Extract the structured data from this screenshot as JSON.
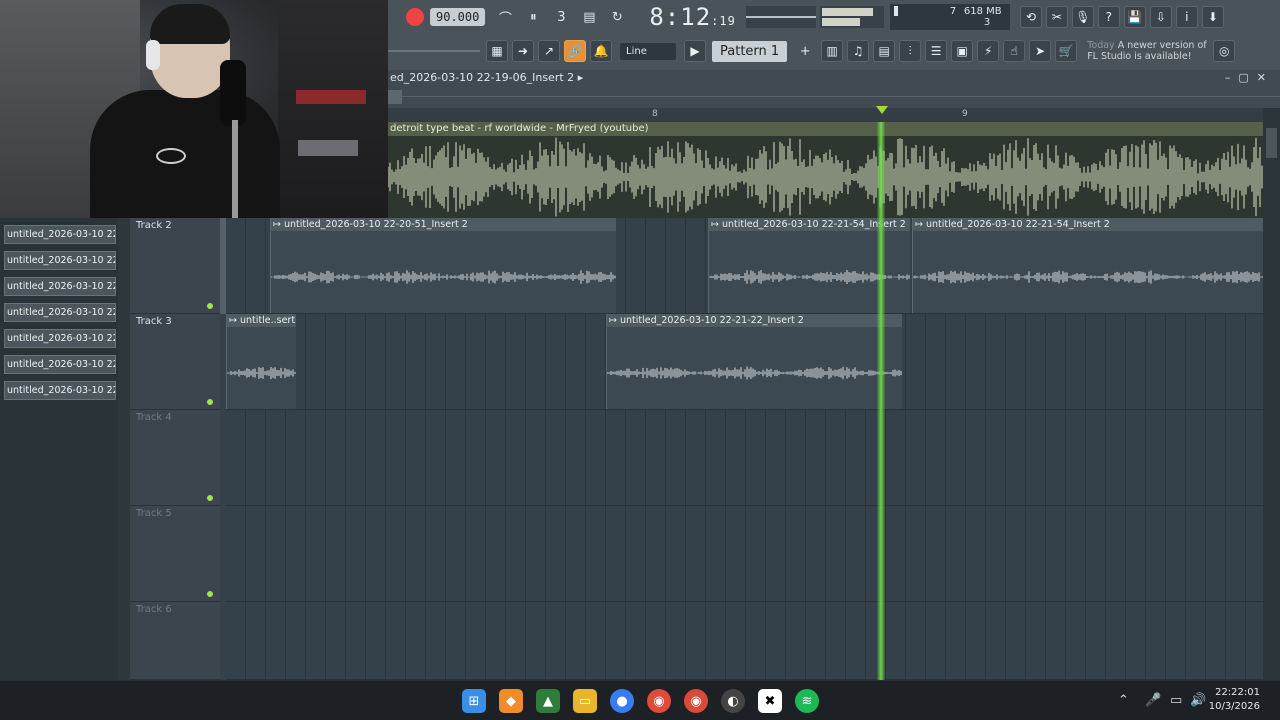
{
  "transport": {
    "tempo": "90.000",
    "time_main": "8:12",
    "time_sub": "19",
    "cpu_value": "7",
    "ram": "618 MB",
    "voices": "3"
  },
  "toolbar": {
    "snap_mode": "Line",
    "pattern": "Pattern 1",
    "news_title": "Today",
    "news_text": "A newer version of FL Studio is available!"
  },
  "playlist": {
    "title": "ed_2026-03-10 22-19-06_Insert 2",
    "ruler": [
      "8",
      "9"
    ],
    "beat_clip": "detroit type beat - rf worldwide - MrFryed (youtube)"
  },
  "browser": {
    "items": [
      "untitled_2026-03-10 22-...",
      "untitled_2026-03-10 22-...",
      "untitled_2026-03-10 22-...",
      "untitled_2026-03-10 22-...",
      "untitled_2026-03-10 22-...",
      "untitled_2026-03-10 22-...",
      "untitled_2026-03-10 22-..."
    ]
  },
  "tracks": [
    {
      "name": "Track 2",
      "clips": [
        "untitled_2026-03-10 22-20-51_Insert 2",
        "untitled_2026-03-10 22-21-54_Insert 2",
        "untitled_2026-03-10 22-21-54_Insert 2"
      ]
    },
    {
      "name": "Track 3",
      "clips": [
        "untitle..sert 2",
        "untitled_2026-03-10 22-21-22_Insert 2"
      ]
    },
    {
      "name": "Track 4",
      "clips": []
    },
    {
      "name": "Track 5",
      "clips": []
    },
    {
      "name": "Track 6",
      "clips": []
    }
  ],
  "taskbar": {
    "time": "22:22:01",
    "date": "10/3/2026"
  },
  "colors": {
    "accent": "#9fdc3a",
    "record": "#e44444",
    "toolbar": "#4a5359"
  }
}
